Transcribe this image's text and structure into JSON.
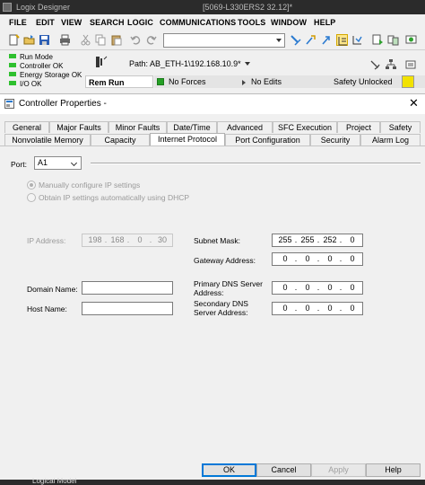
{
  "app": {
    "name": "Logix Designer",
    "project": "[5069-L330ERS2 32.12]*"
  },
  "menu": [
    "FILE",
    "EDIT",
    "VIEW",
    "SEARCH",
    "LOGIC",
    "COMMUNICATIONS",
    "TOOLS",
    "WINDOW",
    "HELP"
  ],
  "toolbar": {
    "combo_value": ""
  },
  "status": {
    "lines": [
      "Run Mode",
      "Controller OK",
      "Energy Storage OK",
      "I/O OK"
    ],
    "path_label": "Path:",
    "path_value": "AB_ETH-1\\192.168.10.9*",
    "mode": "Rem Run",
    "forces": "No Forces",
    "edits": "No Edits",
    "safety": "Safety Unlocked",
    "led_color": "#2ec02e",
    "safety_color": "#f2e200"
  },
  "dialog": {
    "title": "Controller Properties -",
    "tabs_row1": [
      "General",
      "Major Faults",
      "Minor Faults",
      "Date/Time",
      "Advanced",
      "SFC Execution",
      "Project",
      "Safety"
    ],
    "tabs_row2": [
      "Nonvolatile Memory",
      "Capacity",
      "Internet Protocol",
      "Port Configuration",
      "Security",
      "Alarm Log"
    ],
    "active_tab": "Internet Protocol",
    "port_label": "Port:",
    "port_value": "A1",
    "radio_manual": "Manually configure IP settings",
    "radio_dhcp": "Obtain IP settings automatically using DHCP",
    "ip_label": "IP Address:",
    "ip": [
      "198",
      "168",
      "0",
      "30"
    ],
    "subnet_label": "Subnet Mask:",
    "subnet": [
      "255",
      "255",
      "252",
      "0"
    ],
    "gateway_label": "Gateway Address:",
    "gateway": [
      "0",
      "0",
      "0",
      "0"
    ],
    "domain_label": "Domain Name:",
    "domain_value": "",
    "host_label": "Host Name:",
    "host_value": "",
    "dns1_label": "Primary DNS Server Address:",
    "dns1": [
      "0",
      "0",
      "0",
      "0"
    ],
    "dns2_label": "Secondary DNS Server Address:",
    "dns2": [
      "0",
      "0",
      "0",
      "0"
    ],
    "buttons": {
      "ok": "OK",
      "cancel": "Cancel",
      "apply": "Apply",
      "help": "Help"
    }
  },
  "bottom": {
    "text": "Logical Model"
  }
}
